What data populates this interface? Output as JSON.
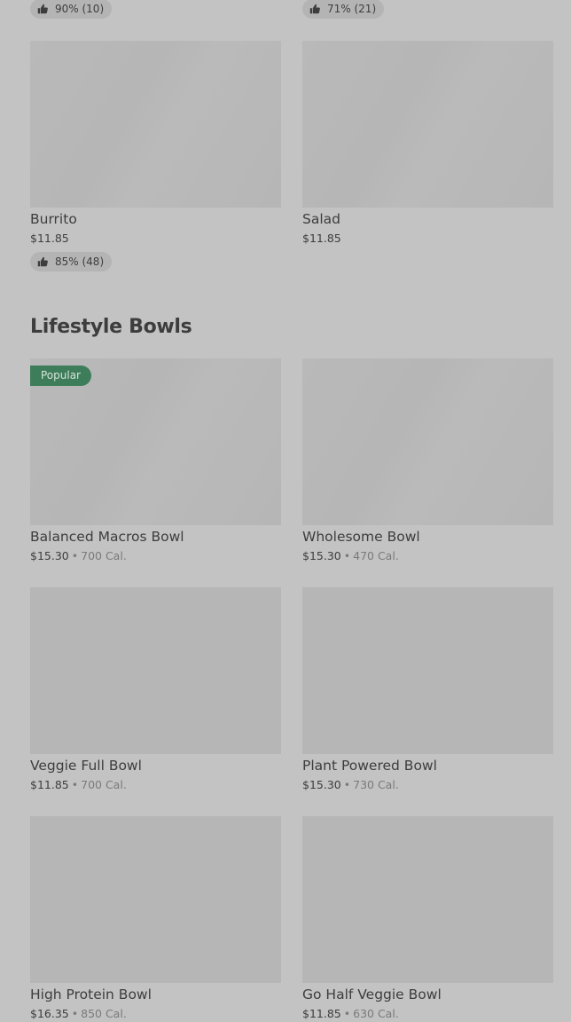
{
  "top_ratings": [
    {
      "text": "90% (10)"
    },
    {
      "text": "71% (21)"
    }
  ],
  "entrees": [
    {
      "name": "Burrito",
      "price": "$11.85",
      "rating": "85% (48)"
    },
    {
      "name": "Salad",
      "price": "$11.85"
    }
  ],
  "lifestyle": {
    "title": "Lifestyle Bowls",
    "items": [
      {
        "name": "Balanced Macros Bowl",
        "price": "$15.30",
        "separator": "•",
        "calories": "700 Cal.",
        "badge": "Popular"
      },
      {
        "name": "Wholesome Bowl",
        "price": "$15.30",
        "separator": "•",
        "calories": "470 Cal."
      },
      {
        "name": "Veggie Full Bowl",
        "price": "$11.85",
        "separator": "•",
        "calories": "700 Cal."
      },
      {
        "name": "Plant Powered Bowl",
        "price": "$15.30",
        "separator": "•",
        "calories": "730 Cal."
      },
      {
        "name": "High Protein Bowl",
        "price": "$16.35",
        "separator": "•",
        "calories": "850 Cal."
      },
      {
        "name": "Go Half Veggie Bowl",
        "price": "$11.85",
        "separator": "•",
        "calories": "630 Cal."
      }
    ]
  },
  "icons": {
    "rating": "thumbs-up-icon"
  },
  "colors": {
    "background": "#c3c3c3",
    "badge": "#3e7d5a"
  }
}
